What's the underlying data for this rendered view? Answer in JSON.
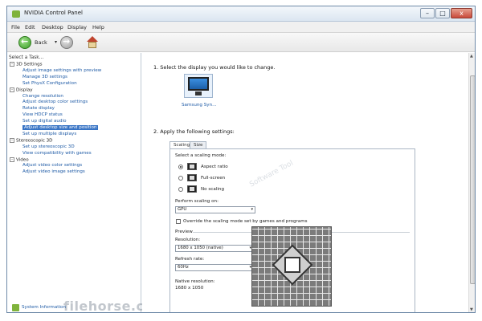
{
  "window": {
    "title": "NVIDIA Control Panel",
    "controls": {
      "minimize": "–",
      "maximize": "□",
      "close": "x"
    }
  },
  "menu": [
    "File",
    "Edit",
    "Desktop",
    "Display",
    "Help"
  ],
  "toolbar": {
    "back_label": "Back",
    "back_dropdown": "▾"
  },
  "left_pane": {
    "header": "Select a Task...",
    "tree": [
      {
        "type": "category",
        "label": "3D Settings",
        "expander": "-"
      },
      {
        "type": "link",
        "label": "Adjust image settings with preview"
      },
      {
        "type": "link",
        "label": "Manage 3D settings"
      },
      {
        "type": "link",
        "label": "Set PhysX Configuration"
      },
      {
        "type": "category",
        "label": "Display",
        "expander": "-"
      },
      {
        "type": "link",
        "label": "Change resolution"
      },
      {
        "type": "link",
        "label": "Adjust desktop color settings"
      },
      {
        "type": "link",
        "label": "Rotate display"
      },
      {
        "type": "link",
        "label": "View HDCP status"
      },
      {
        "type": "link",
        "label": "Set up digital audio"
      },
      {
        "type": "link",
        "label": "Adjust desktop size and position",
        "selected": true
      },
      {
        "type": "link",
        "label": "Set up multiple displays"
      },
      {
        "type": "category",
        "label": "Stereoscopic 3D",
        "expander": "-"
      },
      {
        "type": "link",
        "label": "Set up stereoscopic 3D"
      },
      {
        "type": "link",
        "label": "View compatibility with games"
      },
      {
        "type": "category",
        "label": "Video",
        "expander": "-"
      },
      {
        "type": "link",
        "label": "Adjust video color settings"
      },
      {
        "type": "link",
        "label": "Adjust video image settings"
      }
    ],
    "system_info": "System Information",
    "watermark": "filehorse.com"
  },
  "main": {
    "step1": "1. Select the display you would like to change.",
    "display_label": "Samsung Syn...",
    "step2": "2. Apply the following settings:",
    "tabs": [
      {
        "label": "Scaling",
        "active": true
      },
      {
        "label": "Size",
        "active": false
      }
    ],
    "scaling_mode_label": "Select a scaling mode:",
    "modes": [
      {
        "label": "Aspect ratio",
        "selected": true
      },
      {
        "label": "Full-screen",
        "selected": false
      },
      {
        "label": "No scaling",
        "selected": false
      }
    ],
    "perform_on_label": "Perform scaling on:",
    "perform_on_value": "GPU",
    "override_label": "Override the scaling mode set by games and programs",
    "preview_label": "Preview",
    "resolution_label": "Resolution:",
    "resolution_value": "1680 x 1050 (native)",
    "refresh_label": "Refresh rate:",
    "refresh_value": "60Hz",
    "native_label": "Native resolution:",
    "native_value": "1680 x 1050",
    "watermark": "Software Tool"
  },
  "colors": {
    "link": "#1f5ba6",
    "selected_bg": "#3874c5",
    "nvidia_green": "#7fb33c"
  }
}
